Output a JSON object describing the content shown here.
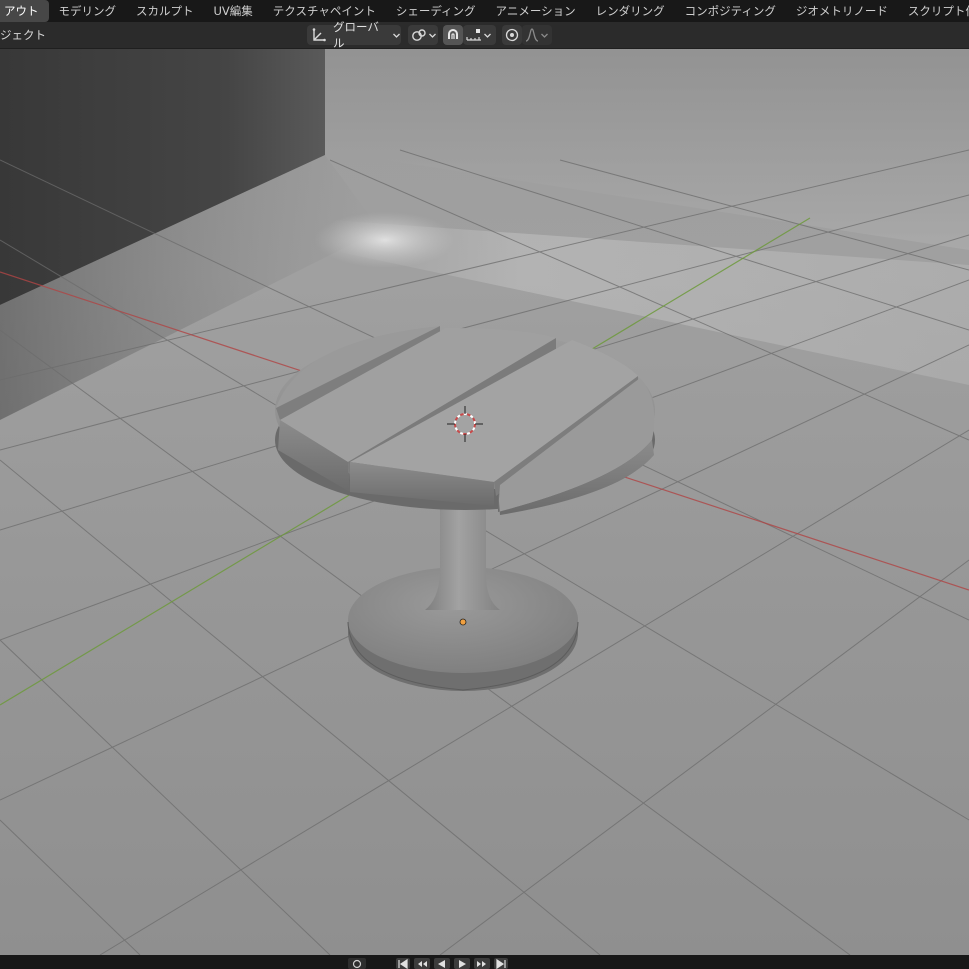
{
  "workspace_tabs": [
    {
      "label": "アウト",
      "active": true
    },
    {
      "label": "モデリング",
      "active": false
    },
    {
      "label": "スカルプト",
      "active": false
    },
    {
      "label": "UV編集",
      "active": false
    },
    {
      "label": "テクスチャペイント",
      "active": false
    },
    {
      "label": "シェーディング",
      "active": false
    },
    {
      "label": "アニメーション",
      "active": false
    },
    {
      "label": "レンダリング",
      "active": false
    },
    {
      "label": "コンポジティング",
      "active": false
    },
    {
      "label": "ジオメトリノード",
      "active": false
    },
    {
      "label": "スクリプト作成",
      "active": false
    }
  ],
  "header": {
    "mode_label": "ジェクト",
    "transform_orientation": "グローバル"
  },
  "colors": {
    "accent_active_tab": "#474747",
    "x_axis": "#b04545",
    "y_axis": "#6e9a3c",
    "origin_point": "#f0a040"
  },
  "icons": [
    "orientation-gizmo-icon",
    "chevron-down-icon",
    "pivot-point-icon",
    "snap-magnet-icon",
    "snap-increment-icon",
    "proportional-edit-icon",
    "falloff-curve-icon",
    "record-icon",
    "jump-start-icon",
    "prev-keyframe-icon",
    "play-reverse-icon",
    "play-icon",
    "next-keyframe-icon",
    "jump-end-icon"
  ]
}
